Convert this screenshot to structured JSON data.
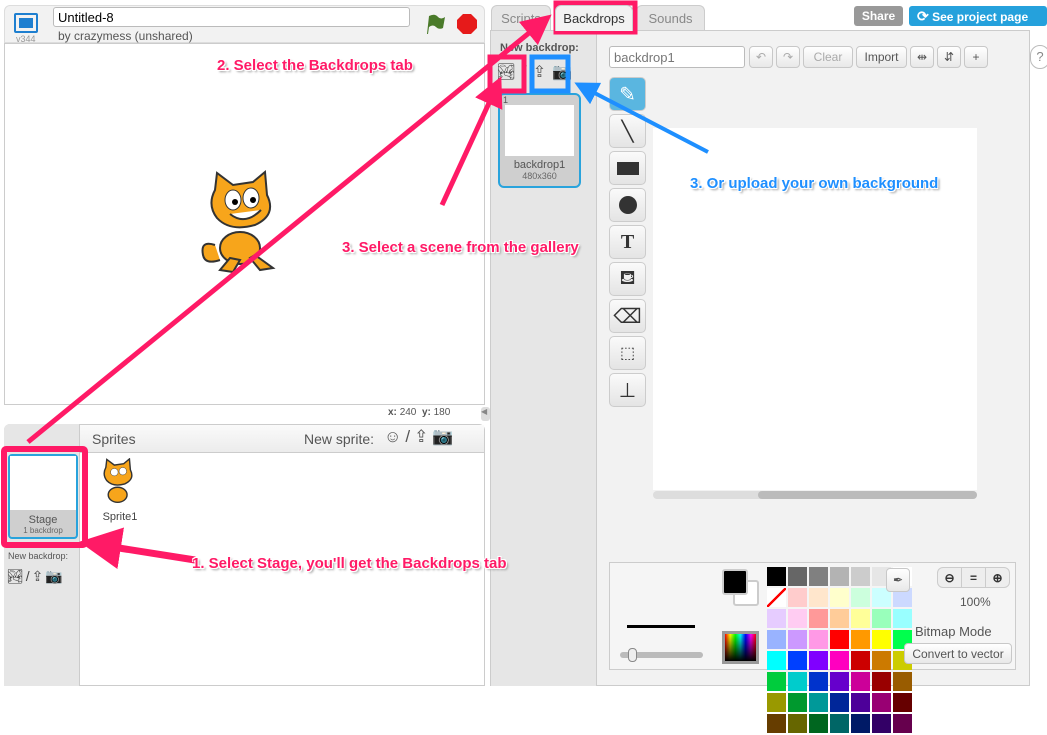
{
  "stage_header": {
    "version": "v344",
    "project_title": "Untitled-8",
    "author": "by crazymess (unshared)"
  },
  "stage": {
    "x_label": "x:",
    "x_value": "240",
    "y_label": "y:",
    "y_value": "180"
  },
  "sprites_panel": {
    "title": "Sprites",
    "new_sprite_label": "New sprite:",
    "stage_label": "Stage",
    "stage_sub": "1 backdrop",
    "new_backdrop_label": "New backdrop:",
    "sprites": [
      {
        "name": "Sprite1"
      }
    ]
  },
  "tabs": [
    {
      "label": "Scripts"
    },
    {
      "label": "Backdrops"
    },
    {
      "label": "Sounds"
    }
  ],
  "top_buttons": {
    "share": "Share",
    "see_project": "See project page"
  },
  "backdrops": {
    "new_backdrop_label": "New backdrop:",
    "items": [
      {
        "index": "1",
        "name": "backdrop1",
        "size": "480x360"
      }
    ]
  },
  "editor": {
    "name_value": "backdrop1",
    "clear": "Clear",
    "import": "Import",
    "zoom": "100%",
    "mode": "Bitmap Mode",
    "convert": "Convert to vector",
    "help": "?"
  },
  "palette": [
    [
      "#000000",
      "#666666",
      "#808080",
      "#b3b3b3",
      "#cccccc",
      "#e6e6e6",
      "#ffffff",
      "none"
    ],
    [
      "#ffcccc",
      "#ffe6cc",
      "#ffffcc",
      "#ccffdd",
      "#ccffff",
      "#ccd9ff",
      "#e6ccff",
      "#ffccf2"
    ],
    [
      "#ff9999",
      "#ffcc99",
      "#ffff99",
      "#99ffbb",
      "#99ffff",
      "#99b3ff",
      "#cc99ff",
      "#ff99e6"
    ],
    [
      "#ff0000",
      "#ff9900",
      "#ffff00",
      "#00ff4d",
      "#00ffff",
      "#0040ff",
      "#8000ff",
      "#ff00bf"
    ],
    [
      "#cc0000",
      "#cc7a00",
      "#cccc00",
      "#00cc3d",
      "#00cccc",
      "#0033cc",
      "#6600cc",
      "#cc0099"
    ],
    [
      "#990000",
      "#995c00",
      "#999900",
      "#00992e",
      "#009999",
      "#002699",
      "#4d0099",
      "#990073"
    ],
    [
      "#660000",
      "#663d00",
      "#666600",
      "#00661f",
      "#006666",
      "#001a66",
      "#330066",
      "#66004d"
    ]
  ],
  "annotations": {
    "step1": "1. Select Stage, you'll get the Backdrops tab",
    "step2": "2. Select the Backdrops tab",
    "step3a": "3. Select a scene from the gallery",
    "step3b": "3. Or upload your own background"
  },
  "colors": {
    "annotation_pink": "#ff1a66",
    "annotation_blue": "#1e8fff",
    "selected_blue": "#29a3dc"
  }
}
